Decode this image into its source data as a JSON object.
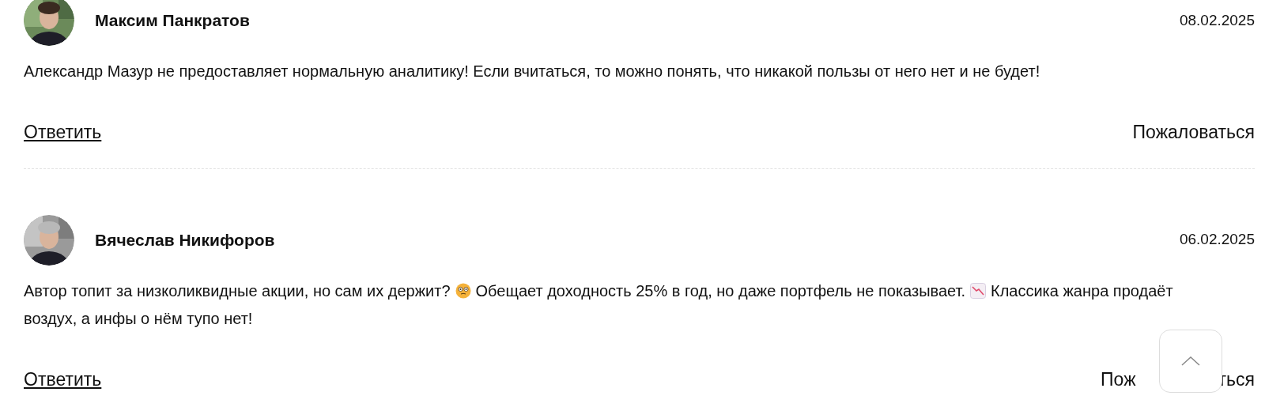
{
  "comments": [
    {
      "author": "Максим Панкратов",
      "date": "08.02.2025",
      "body": [
        {
          "kind": "text",
          "text": "Александр Мазур не предоставляет нормальную аналитику! Если вчитаться, то можно понять, что никакой пользы от него нет и не будет!"
        }
      ],
      "reply": "Ответить",
      "report": [
        "Пожаловаться"
      ]
    },
    {
      "author": "Вячеслав Никифоров",
      "date": "06.02.2025",
      "body": [
        {
          "kind": "text",
          "text": "Автор топит за низколиквидные акции, но сам их держит?"
        },
        {
          "kind": "face"
        },
        {
          "kind": "text",
          "text": "Обещает доходность 25% в год, но даже портфель не показывает."
        },
        {
          "kind": "chart"
        },
        {
          "kind": "text",
          "text": "Классика жанра продаёт воздух, а инфы о нём тупо нет!"
        }
      ],
      "reply": "Ответить",
      "report": [
        "Пож",
        "ться"
      ]
    }
  ]
}
